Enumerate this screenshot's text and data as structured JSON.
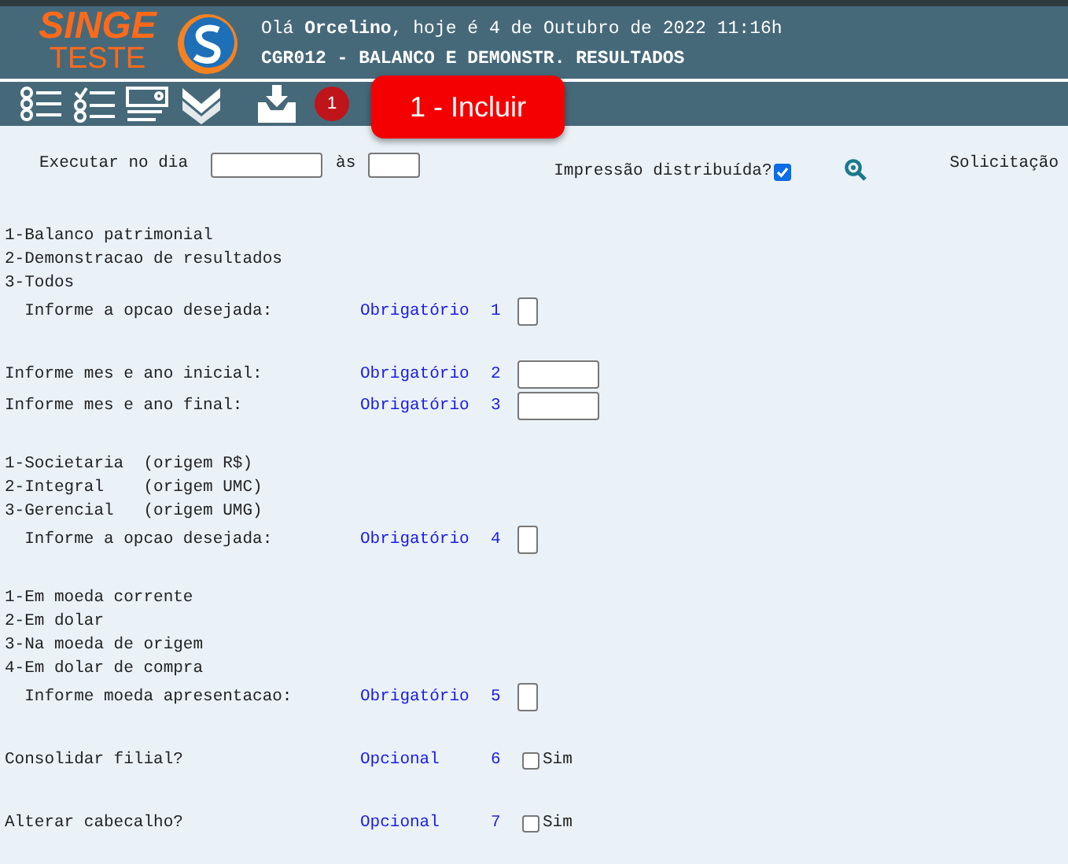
{
  "header": {
    "logo_top": "SINGE",
    "logo_bottom": "TESTE",
    "greeting": "Olá **Orcelino**, hoje é 4 de Outubro de 2022 11:16h",
    "program_title": "CGR012 - BALANCO E DEMONSTR. RESULTADOS"
  },
  "toolbar": {
    "badge": "1",
    "tooltip": "1 - Incluir"
  },
  "schedule": {
    "run_label": "Executar no dia",
    "at_label": "às",
    "distributed_label": "Impressão distribuída?",
    "distributed_checked": true,
    "request_label": "Solicitação"
  },
  "sections": [
    {
      "options": [
        "1-Balanco patrimonial",
        "2-Demonstracao de resultados",
        "3-Todos"
      ],
      "fields": [
        {
          "label": "  Informe a opcao desejada:",
          "requirement": "Obrigatório",
          "number": "1",
          "kind": "box"
        }
      ]
    },
    {
      "fields": [
        {
          "label": "Informe mes e ano inicial:",
          "requirement": "Obrigatório",
          "number": "2",
          "kind": "text"
        },
        {
          "label": "Informe mes e ano final:",
          "requirement": "Obrigatório",
          "number": "3",
          "kind": "text"
        }
      ]
    },
    {
      "options": [
        "1-Societaria  (origem R$)",
        "2-Integral    (origem UMC)",
        "3-Gerencial   (origem UMG)"
      ],
      "fields": [
        {
          "label": "  Informe a opcao desejada:",
          "requirement": "Obrigatório",
          "number": "4",
          "kind": "box"
        }
      ]
    },
    {
      "options": [
        "1-Em moeda corrente",
        "2-Em dolar",
        "3-Na moeda de origem",
        "4-Em dolar de compra"
      ],
      "fields": [
        {
          "label": "  Informe moeda apresentacao:",
          "requirement": "Obrigatório",
          "number": "5",
          "kind": "box"
        }
      ]
    },
    {
      "fields": [
        {
          "label": "Consolidar filial?",
          "requirement": "Opcional",
          "number": "6",
          "kind": "checkbox",
          "checked": false,
          "check_label": "Sim"
        }
      ]
    },
    {
      "fields": [
        {
          "label": "Alterar cabecalho?",
          "requirement": "Opcional",
          "number": "7",
          "kind": "checkbox",
          "checked": false,
          "check_label": "Sim"
        }
      ]
    }
  ]
}
